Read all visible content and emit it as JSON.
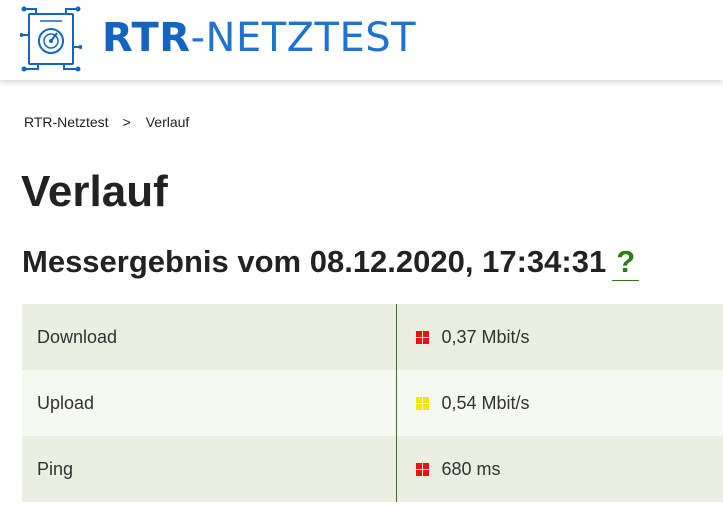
{
  "header": {
    "logo_bold": "RTR",
    "logo_light": "-NETZTEST",
    "logo_icon": "speedometer-circuit-icon",
    "brand_color": "#1565c0"
  },
  "breadcrumb": {
    "home": "RTR-Netztest",
    "separator": ">",
    "current": "Verlauf"
  },
  "page": {
    "title": "Verlauf",
    "result_heading": "Messergebnis vom 08.12.2020, 17:34:31",
    "help_label": "?"
  },
  "results": [
    {
      "label": "Download",
      "value": "0,37 Mbit/s",
      "rating_color": "#ee1111",
      "rating_icon": "traffic-light-red-icon"
    },
    {
      "label": "Upload",
      "value": "0,54 Mbit/s",
      "rating_color": "#f5e800",
      "rating_icon": "traffic-light-yellow-icon"
    },
    {
      "label": "Ping",
      "value": "680 ms",
      "rating_color": "#ee1111",
      "rating_icon": "traffic-light-red-icon"
    }
  ],
  "colors": {
    "row_odd": "#e9efe1",
    "row_even": "#f6f8f2",
    "divider": "#4a6a2a",
    "help_link": "#2e7d14"
  }
}
